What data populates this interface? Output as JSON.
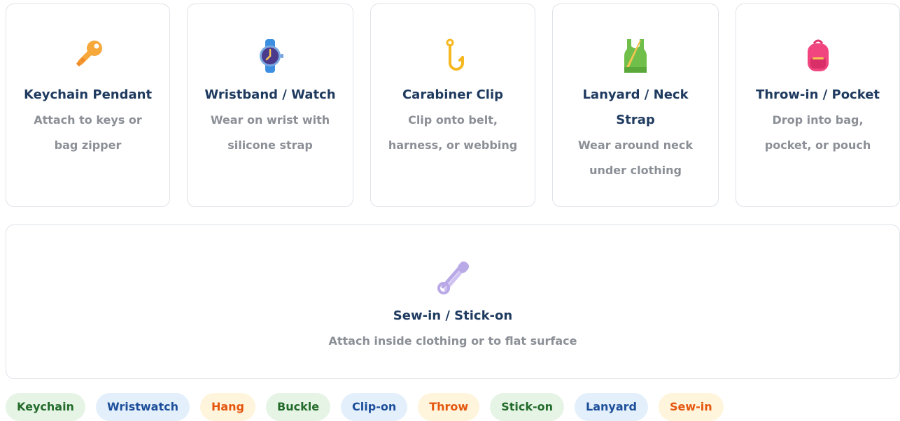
{
  "cards": [
    {
      "icon": "key-icon",
      "title": "Keychain Pendant",
      "desc_lines": [
        "Attach to keys or",
        "bag zipper"
      ]
    },
    {
      "icon": "watch-icon",
      "title": "Wristband / Watch",
      "desc_lines": [
        "Wear on wrist with",
        "silicone strap"
      ]
    },
    {
      "icon": "hook-icon",
      "title": "Carabiner Clip",
      "desc_lines": [
        "Clip onto belt,",
        "harness, or webbing"
      ]
    },
    {
      "icon": "vest-icon",
      "title_lines": [
        "Lanyard / Neck",
        "Strap"
      ],
      "desc_lines": [
        "Wear around neck",
        "under clothing"
      ]
    },
    {
      "icon": "backpack-icon",
      "title": "Throw-in / Pocket",
      "desc_lines": [
        "Drop into bag,",
        "pocket, or pouch"
      ]
    }
  ],
  "wide_card": {
    "icon": "safety-pin-icon",
    "title": "Sew-in / Stick-on",
    "desc": "Attach inside clothing or to flat surface"
  },
  "chips": [
    {
      "label": "Keychain",
      "color": "#236b2b",
      "bg": "#e6f4e6"
    },
    {
      "label": "Wristwatch",
      "color": "#1d4f9a",
      "bg": "#e3effb"
    },
    {
      "label": "Hang",
      "color": "#e4570e",
      "bg": "#fff4dc"
    },
    {
      "label": "Buckle",
      "color": "#236b2b",
      "bg": "#e6f4e6"
    },
    {
      "label": "Clip-on",
      "color": "#1d4f9a",
      "bg": "#e3effb"
    },
    {
      "label": "Throw",
      "color": "#e4570e",
      "bg": "#fff4dc"
    },
    {
      "label": "Stick-on",
      "color": "#236b2b",
      "bg": "#e6f4e6"
    },
    {
      "label": "Lanyard",
      "color": "#1d4f9a",
      "bg": "#e3effb"
    },
    {
      "label": "Sew-in",
      "color": "#e4570e",
      "bg": "#fff4dc"
    }
  ]
}
